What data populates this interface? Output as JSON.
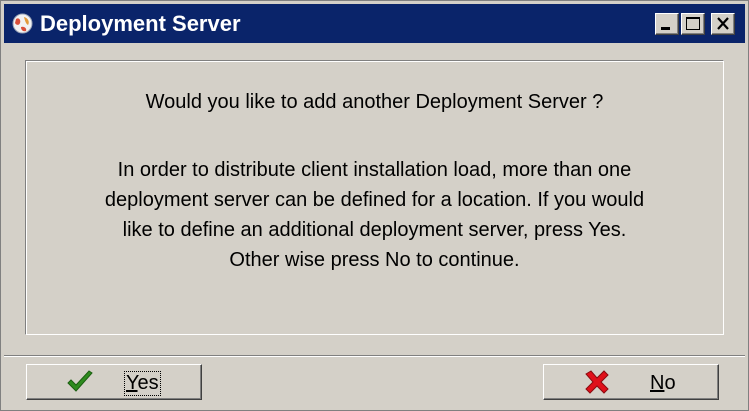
{
  "window": {
    "title": "Deployment Server"
  },
  "dialog": {
    "question": "Would you like to add another Deployment Server ?",
    "description_lines": [
      "In order to distribute client installation load, more than one",
      "deployment server can be defined for a location.  If you would",
      "like to define an additional deployment server, press Yes.",
      "Other wise press No to continue."
    ]
  },
  "buttons": {
    "yes": {
      "label": "Yes",
      "icon": "checkmark-icon",
      "color": "#2e8b1e"
    },
    "no": {
      "label": "No",
      "icon": "red-x-icon",
      "color": "#e0101a"
    }
  },
  "colors": {
    "titlebar": "#0a246a",
    "face": "#d4d0c8"
  }
}
